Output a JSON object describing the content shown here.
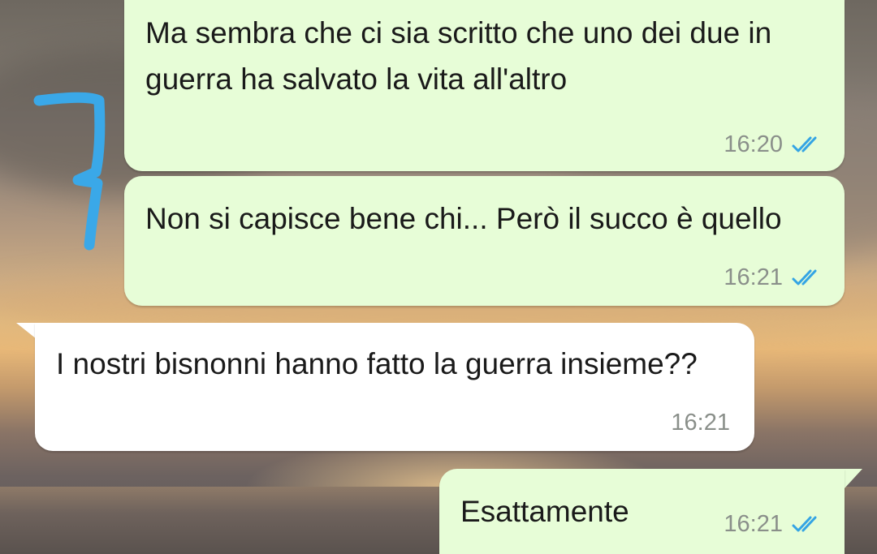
{
  "messages": [
    {
      "direction": "outgoing",
      "text": "Ma sembra che ci sia scritto che uno dei due in guerra ha salvato la vita all'altro",
      "time": "16:20",
      "read_ticks": "double-check-blue-icon"
    },
    {
      "direction": "outgoing",
      "text": "Non si capisce bene chi... Però il succo è quello",
      "time": "16:21",
      "read_ticks": "double-check-blue-icon"
    },
    {
      "direction": "incoming",
      "text": "I nostri bisnonni hanno fatto la guerra insieme??",
      "time": "16:21"
    },
    {
      "direction": "outgoing",
      "text": "Esattamente",
      "time": "16:21",
      "read_ticks": "double-check-blue-icon"
    }
  ],
  "colors": {
    "outgoing_bubble": "#e7fdd7",
    "incoming_bubble": "#ffffff",
    "read_ticks": "#34a4e4",
    "annotation_stroke": "#3aa8e8"
  },
  "annotation": {
    "kind": "hand-drawn-bracket"
  }
}
